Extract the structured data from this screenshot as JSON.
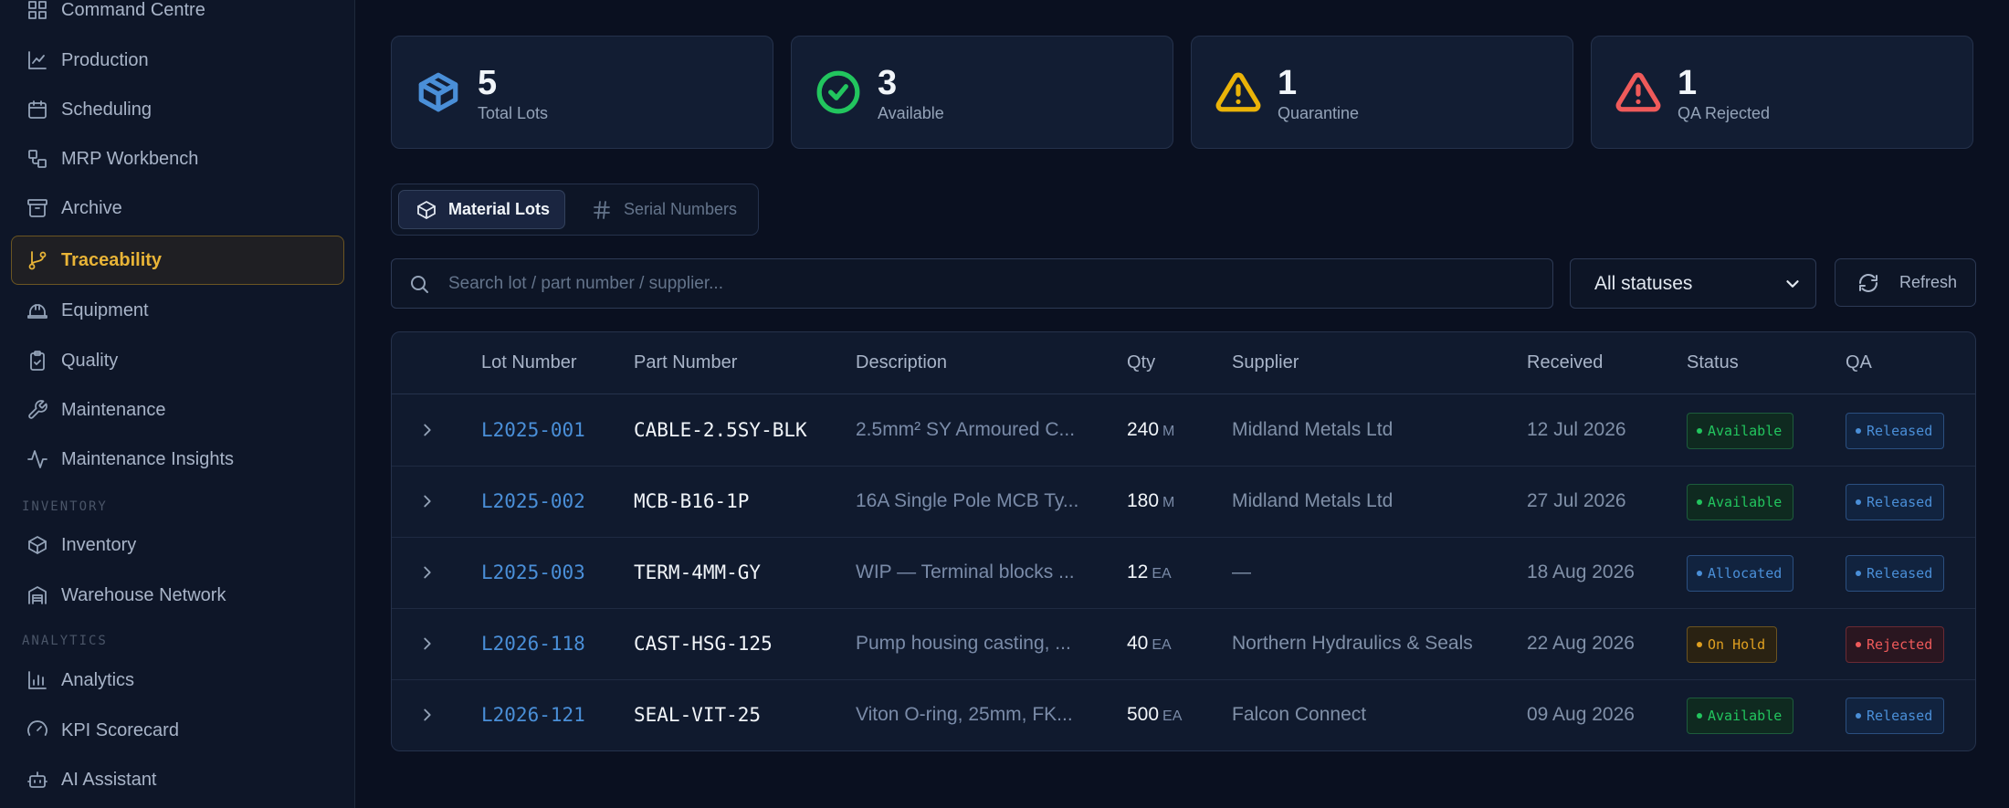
{
  "sidebar": {
    "items": [
      {
        "label": "Command Centre",
        "icon": "grid-icon"
      },
      {
        "label": "Production",
        "icon": "chart-line-icon"
      },
      {
        "label": "Scheduling",
        "icon": "calendar-icon"
      },
      {
        "label": "MRP Workbench",
        "icon": "workflow-icon"
      },
      {
        "label": "Archive",
        "icon": "archive-icon"
      },
      {
        "label": "Traceability",
        "icon": "git-branch-icon"
      },
      {
        "label": "Equipment",
        "icon": "hard-hat-icon"
      },
      {
        "label": "Quality",
        "icon": "clipboard-check-icon"
      },
      {
        "label": "Maintenance",
        "icon": "wrench-icon"
      },
      {
        "label": "Maintenance Insights",
        "icon": "activity-icon"
      }
    ],
    "inventory_section": "INVENTORY",
    "inventory_items": [
      {
        "label": "Inventory",
        "icon": "package-icon"
      },
      {
        "label": "Warehouse Network",
        "icon": "warehouse-icon"
      }
    ],
    "analytics_section": "ANALYTICS",
    "analytics_items": [
      {
        "label": "Analytics",
        "icon": "bar-chart-icon"
      },
      {
        "label": "KPI Scorecard",
        "icon": "gauge-icon"
      },
      {
        "label": "AI Assistant",
        "icon": "bot-icon"
      }
    ]
  },
  "stats": [
    {
      "value": "5",
      "label": "Total Lots",
      "icon": "package-icon",
      "color": "#4a8fd8"
    },
    {
      "value": "3",
      "label": "Available",
      "icon": "check-circle-icon",
      "color": "#22c55e"
    },
    {
      "value": "1",
      "label": "Quarantine",
      "icon": "warning-icon",
      "color": "#eab308"
    },
    {
      "value": "1",
      "label": "QA Rejected",
      "icon": "alert-triangle-icon",
      "color": "#ef5a5a"
    }
  ],
  "tabs": {
    "material_lots": "Material Lots",
    "serial_numbers": "Serial Numbers"
  },
  "search": {
    "placeholder": "Search lot / part number / supplier...",
    "value": ""
  },
  "filter": {
    "selected": "All statuses"
  },
  "refresh_label": "Refresh",
  "table": {
    "headers": [
      "Lot Number",
      "Part Number",
      "Description",
      "Qty",
      "Supplier",
      "Received",
      "Status",
      "QA"
    ],
    "rows": [
      {
        "lot": "L2025-001",
        "part": "CABLE-2.5SY-BLK",
        "desc": "2.5mm² SY Armoured C...",
        "qty": "240",
        "unit": "M",
        "supplier": "Midland Metals Ltd",
        "received": "12 Jul 2026",
        "status": "Available",
        "qa": "Released"
      },
      {
        "lot": "L2025-002",
        "part": "MCB-B16-1P",
        "desc": "16A Single Pole MCB Ty...",
        "qty": "180",
        "unit": "M",
        "supplier": "Midland Metals Ltd",
        "received": "27 Jul 2026",
        "status": "Available",
        "qa": "Released"
      },
      {
        "lot": "L2025-003",
        "part": "TERM-4MM-GY",
        "desc": "WIP — Terminal blocks ...",
        "qty": "12",
        "unit": "EA",
        "supplier": "—",
        "received": "18 Aug 2026",
        "status": "Allocated",
        "qa": "Released"
      },
      {
        "lot": "L2026-118",
        "part": "CAST-HSG-125",
        "desc": "Pump housing casting, ...",
        "qty": "40",
        "unit": "EA",
        "supplier": "Northern Hydraulics & Seals",
        "received": "22 Aug 2026",
        "status": "On Hold",
        "qa": "Rejected"
      },
      {
        "lot": "L2026-121",
        "part": "SEAL-VIT-25",
        "desc": "Viton O-ring, 25mm, FK...",
        "qty": "500",
        "unit": "EA",
        "supplier": "Falcon Connect",
        "received": "09 Aug 2026",
        "status": "Available",
        "qa": "Released"
      }
    ]
  },
  "colors": {
    "accent": "#e8b437",
    "link": "#4a8fd8",
    "available": "#22c55e",
    "allocated": "#4a8fd8",
    "on_hold": "#eab308",
    "rejected": "#ef5a5a",
    "released": "#4a8fd8"
  }
}
